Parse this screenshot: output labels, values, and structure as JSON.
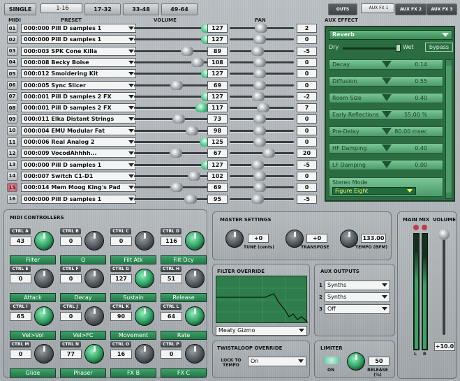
{
  "top_tabs": [
    {
      "label": "SINGLE",
      "selected": false
    },
    {
      "label": "1-16",
      "selected": true
    },
    {
      "label": "17-32",
      "selected": false
    },
    {
      "label": "33-48",
      "selected": false
    },
    {
      "label": "49-64",
      "selected": false
    }
  ],
  "right_tabs": [
    {
      "label": "OUTS",
      "selected": false
    },
    {
      "label": "AUX FX 1",
      "selected": true
    },
    {
      "label": "AUX FX 2",
      "selected": false
    },
    {
      "label": "AUX FX 3",
      "selected": false
    }
  ],
  "headers": {
    "midi": "MIDI",
    "preset": "PRESET",
    "volume": "VOLUME",
    "pan": "PAN",
    "aux_effect": "AUX EFFECT"
  },
  "channels": [
    {
      "num": "01",
      "preset": "000:000 Pill D samples 1",
      "volume": "127",
      "vol_level": 1.0,
      "pan": "2",
      "pan_level": 0.52
    },
    {
      "num": "02",
      "preset": "000:000 Pill D samples 1",
      "volume": "127",
      "vol_level": 1.0,
      "pan": "0",
      "pan_level": 0.5
    },
    {
      "num": "03",
      "preset": "000:003 SPK Cone Killa",
      "volume": "89",
      "vol_level": 0.7,
      "pan": "-5",
      "pan_level": 0.46
    },
    {
      "num": "04",
      "preset": "000:008 Becky Boise",
      "volume": "108",
      "vol_level": 0.85,
      "pan": "0",
      "pan_level": 0.5
    },
    {
      "num": "05",
      "preset": "000:012 Smoldering Kit",
      "volume": "127",
      "vol_level": 1.0,
      "pan": "0",
      "pan_level": 0.5
    },
    {
      "num": "06",
      "preset": "000:005 Sync Slicer",
      "volume": "69",
      "vol_level": 0.54,
      "pan": "0",
      "pan_level": 0.5
    },
    {
      "num": "07",
      "preset": "000:001  Pill D samples 2 FX",
      "volume": "127",
      "vol_level": 1.0,
      "pan": "-2",
      "pan_level": 0.48
    },
    {
      "num": "08",
      "preset": "000:001  Pill D samples 2 FX",
      "volume": "117",
      "vol_level": 0.92,
      "pan": "7",
      "pan_level": 0.56
    },
    {
      "num": "09",
      "preset": "000:011 Elka Distant Strings",
      "volume": "73",
      "vol_level": 0.57,
      "pan": "0",
      "pan_level": 0.5
    },
    {
      "num": "10",
      "preset": "000:004 EMU Modular Fat",
      "volume": "98",
      "vol_level": 0.77,
      "pan": "0",
      "pan_level": 0.5
    },
    {
      "num": "11",
      "preset": "000:006 Real Analog 2",
      "volume": "125",
      "vol_level": 0.98,
      "pan": "0",
      "pan_level": 0.5
    },
    {
      "num": "12",
      "preset": "000:009 VocodAhhhh...",
      "volume": "67",
      "vol_level": 0.53,
      "pan": "20",
      "pan_level": 0.66
    },
    {
      "num": "13",
      "preset": "000:000 Pill D samples 1",
      "volume": "127",
      "vol_level": 1.0,
      "pan": "-5",
      "pan_level": 0.46
    },
    {
      "num": "14",
      "preset": "000:007 Switch C1-D1",
      "volume": "102",
      "vol_level": 0.8,
      "pan": "0",
      "pan_level": 0.5
    },
    {
      "num": "15",
      "preset": "000:014 Mem Moog King's Pad",
      "volume": "69",
      "vol_level": 0.54,
      "pan": "0",
      "pan_level": 0.5
    },
    {
      "num": "16",
      "preset": "000:000 Pill D samples 1",
      "volume": "95",
      "vol_level": 0.75,
      "pan": "-5",
      "pan_level": 0.46
    }
  ],
  "aux_effect": {
    "selected": "Reverb",
    "dry": "Dry",
    "wet": "Wet",
    "bypass": "bypass",
    "params": [
      {
        "label": "Decay",
        "value": "0.14"
      },
      {
        "label": "Diffusion",
        "value": "0.55"
      },
      {
        "label": "Room Size",
        "value": "0.40"
      },
      {
        "label": "Early Reflections",
        "value": "55.00 %"
      },
      {
        "label": "Pre-Delay",
        "value": "80.00 msec"
      },
      {
        "label": "HF Damping",
        "value": "0.40"
      },
      {
        "label": "LF Damping",
        "value": "0.00"
      }
    ],
    "stereo_mode_label": "Stereo Mode",
    "stereo_mode_value": "Figure Eight"
  },
  "midi_controllers": {
    "title": "MIDI CONTROLLERS",
    "items": [
      {
        "tag": "CTRL A",
        "value": "43",
        "name": "Filter",
        "green": true
      },
      {
        "tag": "CTRL B",
        "value": "0",
        "name": "Q",
        "green": false
      },
      {
        "tag": "CTRL C",
        "value": "0",
        "name": "Filt Atk",
        "green": false
      },
      {
        "tag": "CTRL D",
        "value": "116",
        "name": "Filt Dcy",
        "green": true
      },
      {
        "tag": "CTRL E",
        "value": "0",
        "name": "Attack",
        "green": false
      },
      {
        "tag": "CTRL F",
        "value": "0",
        "name": "Decay",
        "green": false
      },
      {
        "tag": "CTRL G",
        "value": "127",
        "name": "Sustain",
        "green": true
      },
      {
        "tag": "CTRL H",
        "value": "51",
        "name": "Release",
        "green": false
      },
      {
        "tag": "CTRL I",
        "value": "65",
        "name": "Vel>Vol",
        "green": true
      },
      {
        "tag": "CTRL J",
        "value": "0",
        "name": "Vel>FC",
        "green": false
      },
      {
        "tag": "CTRL K",
        "value": "90",
        "name": "Movement",
        "green": true
      },
      {
        "tag": "CTRL L",
        "value": "64",
        "name": "Rate",
        "green": true
      },
      {
        "tag": "CTRL M",
        "value": "0",
        "name": "Glide",
        "green": false
      },
      {
        "tag": "CTRL N",
        "value": "77",
        "name": "Phaser",
        "green": true
      },
      {
        "tag": "CTRL O",
        "value": "16",
        "name": "FX B",
        "green": false
      },
      {
        "tag": "CTRL P",
        "value": "0",
        "name": "FX C",
        "green": false
      }
    ]
  },
  "master_settings": {
    "title": "MASTER SETTINGS",
    "tune_value": "+0",
    "tune_label": "TUNE (cents)",
    "transpose_value": "+0",
    "transpose_label": "TRANSPOSE",
    "tempo_value": "133.00",
    "tempo_label": "TEMPO (BPM)"
  },
  "filter_override": {
    "title": "FILTER OVERRIDE",
    "selected": "Meaty Gizmo"
  },
  "twistaloop_override": {
    "title": "TWISTALOOP OVERRIDE",
    "lock_label": "LOCK TO TEMPO",
    "selected": "On"
  },
  "aux_outputs": {
    "title": "AUX OUTPUTS",
    "items": [
      {
        "n": "1",
        "value": "Synths"
      },
      {
        "n": "2",
        "value": "Synths"
      },
      {
        "n": "3",
        "value": "Off"
      }
    ]
  },
  "limiter": {
    "title": "LIMITER",
    "on_label": "ON",
    "release_value": "50",
    "release_label": "RELEASE (%)"
  },
  "main_mix": {
    "title": "MAIN MIX",
    "volume_title": "VOLUME",
    "left": "L",
    "right": "R",
    "volume_value": "+10.0",
    "left_level": 0.85,
    "right_level": 0.8
  }
}
